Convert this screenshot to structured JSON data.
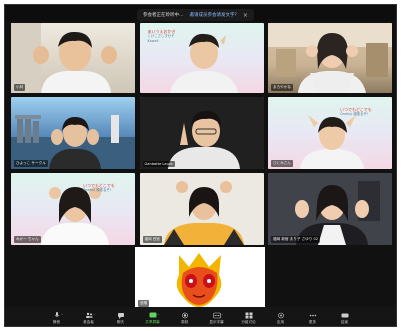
{
  "window": {
    "notice_text": "参会者正在聆听中…",
    "notice_link": "邀请成员参会请发文字?",
    "close_symbol": "×"
  },
  "participants": [
    {
      "name": "小林"
    },
    {
      "name": "",
      "caption_lines": [
        "あいうえおかき",
        "くけこさしすせそ",
        "Kawaii"
      ]
    },
    {
      "name": "まろやかな",
      "caption_lines": []
    },
    {
      "name": "ひよっこ サークル"
    },
    {
      "name": "Ganbatte Laura"
    },
    {
      "name": "ひとみさん",
      "caption_lines": [
        "いつでもどこでも",
        "Onehuj 頑張るぞ!"
      ]
    },
    {
      "name": "みかー ちゃん",
      "caption_lines": [
        "いつでもどこでも",
        "Onehuj 頑張るぞ!"
      ]
    },
    {
      "name": "福岡 西宮"
    },
    {
      "name": "福岡 新宿 まり子 さゆり 02"
    },
    {
      "name": "悠陽"
    }
  ],
  "toolbar": {
    "items": [
      {
        "label": "静音",
        "icon": "mic-icon"
      },
      {
        "label": "参会者",
        "icon": "participants-icon"
      },
      {
        "label": "聊天",
        "icon": "chat-icon"
      },
      {
        "label": "共享屏幕",
        "icon": "share-screen-icon"
      },
      {
        "label": "录制",
        "icon": "record-icon"
      },
      {
        "label": "显示字幕",
        "icon": "captions-icon"
      },
      {
        "label": "分组讨论",
        "icon": "breakout-icon"
      },
      {
        "label": "应用",
        "icon": "apps-icon"
      },
      {
        "label": "更多",
        "icon": "more-icon"
      },
      {
        "label": "结束",
        "icon": "end-icon"
      }
    ]
  },
  "colors": {
    "share_green": "#5fd35f",
    "active_outline": "#e8d95a"
  }
}
